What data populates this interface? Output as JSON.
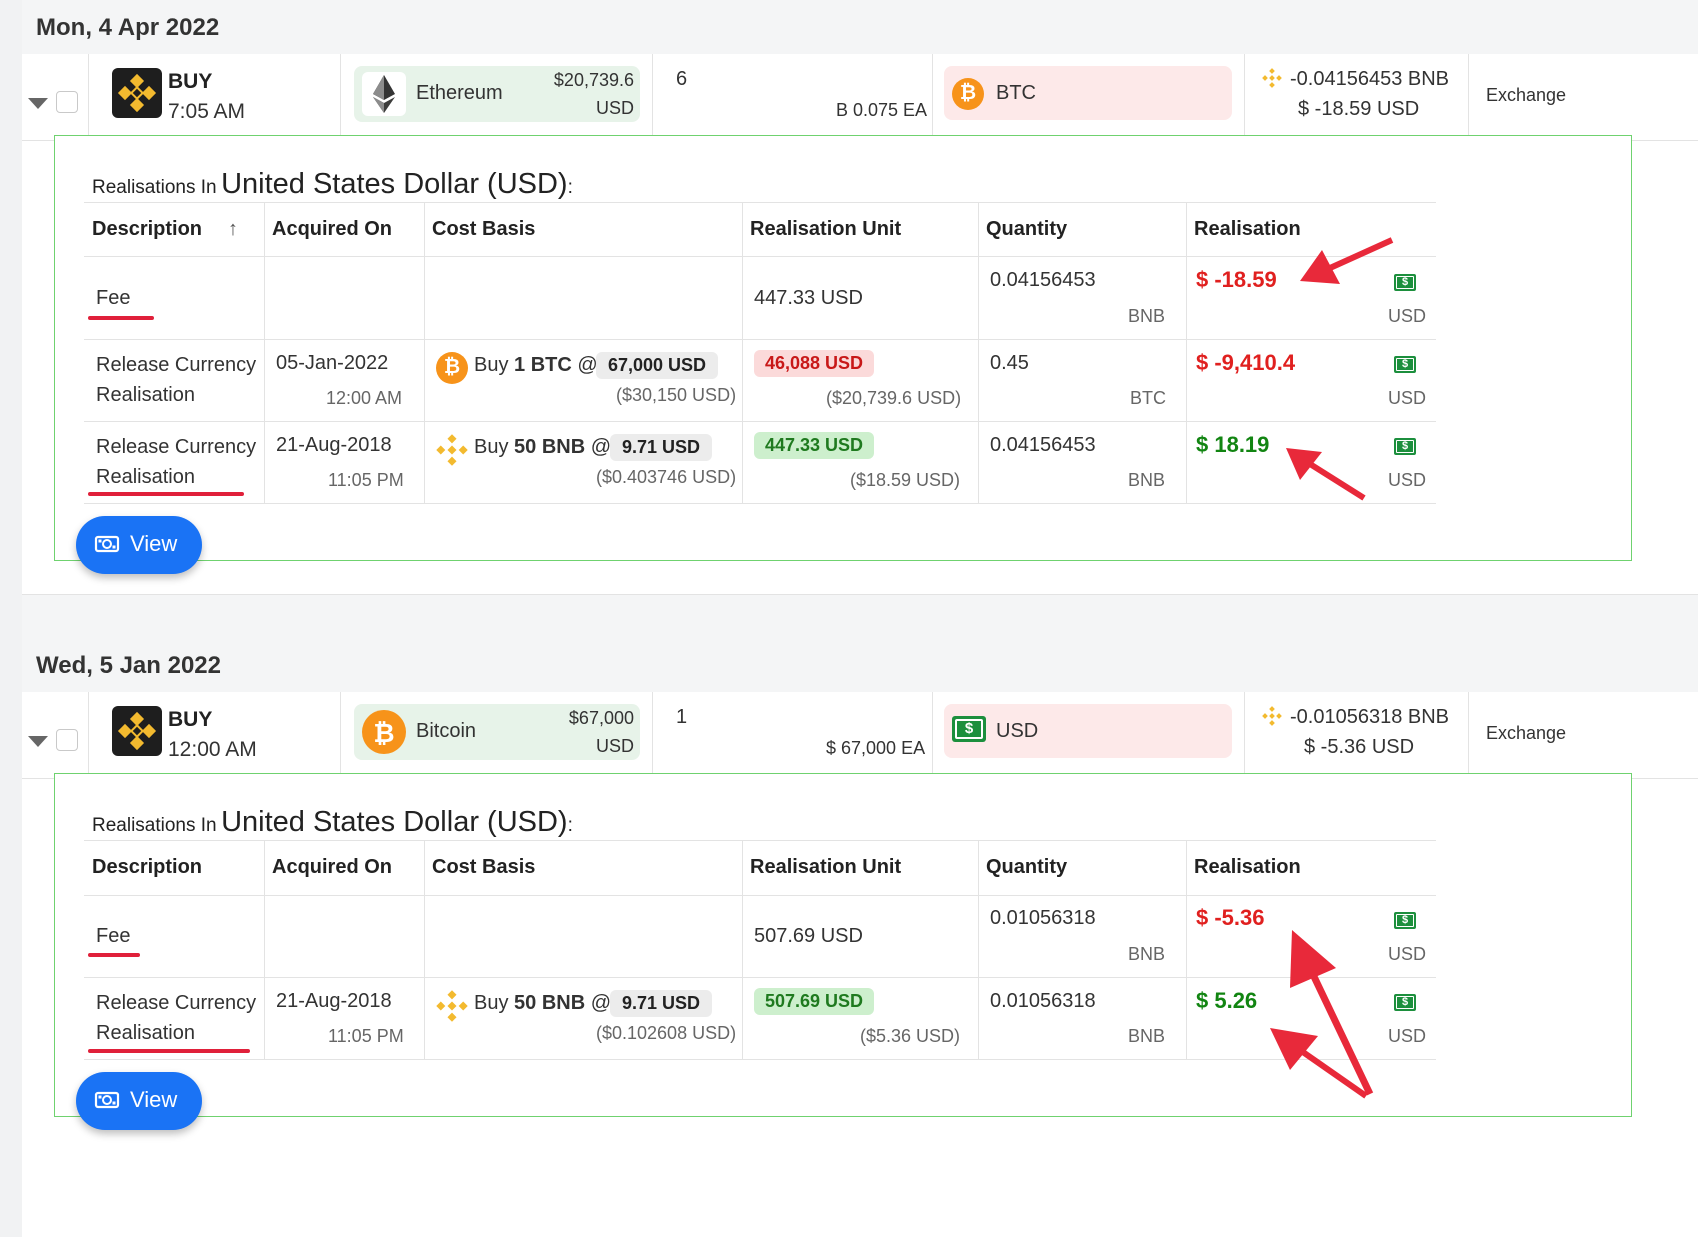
{
  "days": [
    {
      "date": "Mon, 4 Apr 2022",
      "tx": {
        "action": "BUY",
        "time": "7:05 AM",
        "asset_name": "Ethereum",
        "asset_price": "$20,739.6",
        "asset_currency": "USD",
        "quantity": "6",
        "unit_price": "B 0.075 EA",
        "pay_currency": "BTC",
        "fee_amount": "-0.04156453 BNB",
        "fee_usd": "$ -18.59 USD",
        "type": "Exchange"
      },
      "realisations": {
        "title_prefix": "Realisations In",
        "title_currency": "United States Dollar (USD)",
        "title_suffix": ":",
        "headers": [
          "Description",
          "Acquired On",
          "Cost Basis",
          "Realisation Unit",
          "Quantity",
          "Realisation"
        ],
        "sort_icon": "↑",
        "rows": [
          {
            "desc1": "Fee",
            "desc2": "",
            "acq_date": "",
            "acq_time": "",
            "cost_prefix": "",
            "cost_qty": "",
            "cost_sym": "",
            "cost_at": "",
            "cost_price": "",
            "cost_total": "",
            "unit": "447.33 USD",
            "unit_total": "",
            "qty": "0.04156453",
            "qty_unit": "BNB",
            "real": "$ -18.59",
            "real_unit": "USD"
          },
          {
            "desc1": "Release Currency",
            "desc2": "Realisation",
            "acq_date": "05-Jan-2022",
            "acq_time": "12:00 AM",
            "cost_prefix": "Buy",
            "cost_qty": "1 BTC",
            "cost_sym": "",
            "cost_at": "@",
            "cost_price": "67,000 USD",
            "cost_total": "($30,150 USD)",
            "unit": "46,088 USD",
            "unit_total": "($20,739.6 USD)",
            "qty": "0.45",
            "qty_unit": "BTC",
            "real": "$ -9,410.4",
            "real_unit": "USD"
          },
          {
            "desc1": "Release Currency",
            "desc2": "Realisation",
            "acq_date": "21-Aug-2018",
            "acq_time": "11:05 PM",
            "cost_prefix": "Buy",
            "cost_qty": "50 BNB",
            "cost_sym": "",
            "cost_at": "@",
            "cost_price": "9.71 USD",
            "cost_total": "($0.403746 USD)",
            "unit": "447.33 USD",
            "unit_total": "($18.59 USD)",
            "qty": "0.04156453",
            "qty_unit": "BNB",
            "real": "$ 18.19",
            "real_unit": "USD"
          }
        ],
        "view_label": "View"
      }
    },
    {
      "date": "Wed, 5 Jan 2022",
      "tx": {
        "action": "BUY",
        "time": "12:00 AM",
        "asset_name": "Bitcoin",
        "asset_price": "$67,000",
        "asset_currency": "USD",
        "quantity": "1",
        "unit_price": "$ 67,000 EA",
        "pay_currency": "USD",
        "fee_amount": "-0.01056318 BNB",
        "fee_usd": "$ -5.36 USD",
        "type": "Exchange"
      },
      "realisations": {
        "title_prefix": "Realisations In",
        "title_currency": "United States Dollar (USD)",
        "title_suffix": ":",
        "headers": [
          "Description",
          "Acquired On",
          "Cost Basis",
          "Realisation Unit",
          "Quantity",
          "Realisation"
        ],
        "rows": [
          {
            "desc1": "Fee",
            "desc2": "",
            "acq_date": "",
            "acq_time": "",
            "cost_prefix": "",
            "cost_qty": "",
            "cost_at": "",
            "cost_price": "",
            "cost_total": "",
            "unit": "507.69 USD",
            "unit_total": "",
            "qty": "0.01056318",
            "qty_unit": "BNB",
            "real": "$ -5.36",
            "real_unit": "USD"
          },
          {
            "desc1": "Release Currency",
            "desc2": "Realisation",
            "acq_date": "21-Aug-2018",
            "acq_time": "11:05 PM",
            "cost_prefix": "Buy",
            "cost_qty": "50 BNB",
            "cost_at": "@",
            "cost_price": "9.71 USD",
            "cost_total": "($0.102608 USD)",
            "unit": "507.69 USD",
            "unit_total": "($5.36 USD)",
            "qty": "0.01056318",
            "qty_unit": "BNB",
            "real": "$ 5.26",
            "real_unit": "USD"
          }
        ],
        "view_label": "View"
      }
    }
  ],
  "icons": {
    "exchange_logo": "binance-logo-icon",
    "eth": "ethereum-icon",
    "btc": "bitcoin-icon",
    "bnb": "bnb-icon",
    "cash": "cash-icon",
    "view": "eye-money-icon"
  },
  "colors": {
    "accent_blue": "#1a73f5",
    "loss_red": "#e0201f",
    "gain_green": "#128512",
    "panel_border": "#6fd26f",
    "annotation_red": "#e8293a"
  }
}
